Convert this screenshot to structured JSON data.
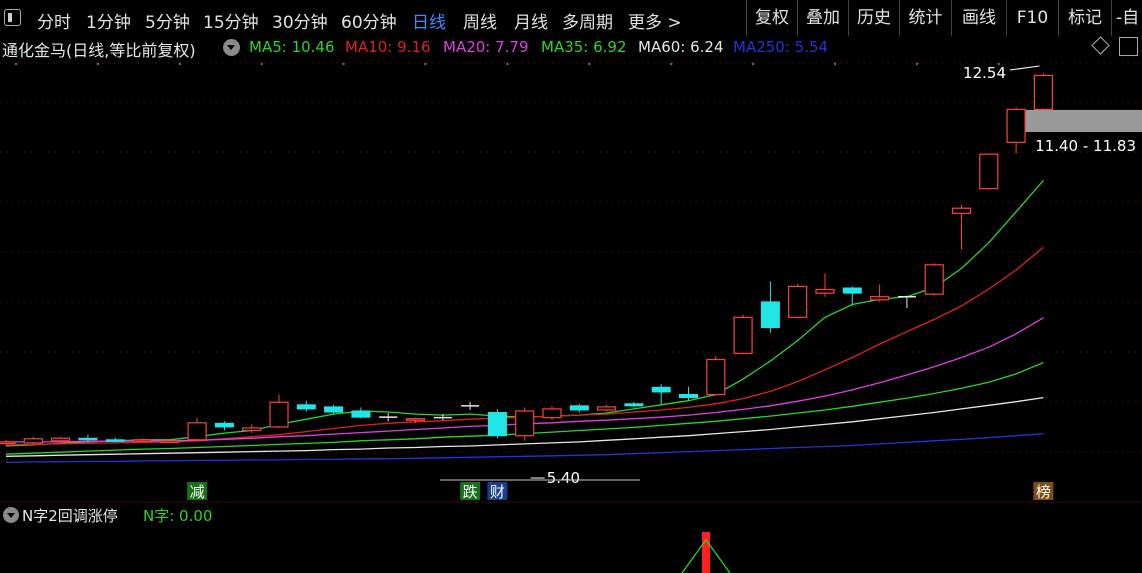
{
  "toolbar": {
    "periods": [
      "分时",
      "1分钟",
      "5分钟",
      "15分钟",
      "30分钟",
      "60分钟",
      "日线",
      "周线",
      "月线",
      "多周期",
      "更多 >"
    ],
    "active_period": "日线",
    "tools": [
      "复权",
      "叠加",
      "历史",
      "统计",
      "画线",
      "F10",
      "标记",
      "-自"
    ]
  },
  "legend": {
    "title": "通化金马(日线,等比前复权)",
    "ma": [
      {
        "label": "MA5: 10.46",
        "color": "#28d628"
      },
      {
        "label": "MA10: 9.16",
        "color": "#e02020"
      },
      {
        "label": "MA20: 7.79",
        "color": "#e040e0"
      },
      {
        "label": "MA35: 6.92",
        "color": "#28d628"
      },
      {
        "label": "MA60: 6.24",
        "color": "#e6e6e6"
      },
      {
        "label": "MA250: 5.54",
        "color": "#2233dd"
      }
    ]
  },
  "chart_data": {
    "type": "candlestick",
    "ylim": [
      4.6,
      12.8
    ],
    "up_color": "#ff4040",
    "down_color": "#20e6e6",
    "candles": [
      {
        "o": 5.35,
        "c": 5.38,
        "h": 5.42,
        "l": 5.3
      },
      {
        "o": 5.36,
        "c": 5.44,
        "h": 5.48,
        "l": 5.33
      },
      {
        "o": 5.4,
        "c": 5.45,
        "h": 5.48,
        "l": 5.38
      },
      {
        "o": 5.45,
        "c": 5.42,
        "h": 5.52,
        "l": 5.38
      },
      {
        "o": 5.42,
        "c": 5.4,
        "h": 5.46,
        "l": 5.37
      },
      {
        "o": 5.4,
        "c": 5.42,
        "h": 5.45,
        "l": 5.38
      },
      {
        "o": 5.38,
        "c": 5.4,
        "h": 5.43,
        "l": 5.35
      },
      {
        "o": 5.42,
        "c": 5.75,
        "h": 5.85,
        "l": 5.4
      },
      {
        "o": 5.74,
        "c": 5.67,
        "h": 5.78,
        "l": 5.6
      },
      {
        "o": 5.6,
        "c": 5.65,
        "h": 5.72,
        "l": 5.55
      },
      {
        "o": 5.67,
        "c": 6.15,
        "h": 6.3,
        "l": 5.65
      },
      {
        "o": 6.1,
        "c": 6.02,
        "h": 6.18,
        "l": 5.97
      },
      {
        "o": 6.06,
        "c": 5.96,
        "h": 6.1,
        "l": 5.92
      },
      {
        "o": 5.98,
        "c": 5.86,
        "h": 6.05,
        "l": 5.84
      },
      {
        "o": 5.86,
        "c": 5.86,
        "h": 5.94,
        "l": 5.78
      },
      {
        "o": 5.8,
        "c": 5.83,
        "h": 5.85,
        "l": 5.75
      },
      {
        "o": 5.85,
        "c": 5.85,
        "h": 5.92,
        "l": 5.8
      },
      {
        "o": 6.08,
        "c": 6.08,
        "h": 6.16,
        "l": 6.0
      },
      {
        "o": 5.95,
        "c": 5.5,
        "h": 6.02,
        "l": 5.45
      },
      {
        "o": 5.5,
        "c": 5.98,
        "h": 6.05,
        "l": 5.4
      },
      {
        "o": 5.85,
        "c": 6.02,
        "h": 6.08,
        "l": 5.8
      },
      {
        "o": 6.08,
        "c": 6.0,
        "h": 6.12,
        "l": 5.95
      },
      {
        "o": 6.0,
        "c": 6.06,
        "h": 6.1,
        "l": 5.97
      },
      {
        "o": 6.12,
        "c": 6.08,
        "h": 6.16,
        "l": 6.05
      },
      {
        "o": 6.44,
        "c": 6.35,
        "h": 6.5,
        "l": 6.1
      },
      {
        "o": 6.3,
        "c": 6.24,
        "h": 6.45,
        "l": 6.18
      },
      {
        "o": 6.3,
        "c": 6.98,
        "h": 7.05,
        "l": 6.28
      },
      {
        "o": 7.1,
        "c": 7.8,
        "h": 7.85,
        "l": 7.08
      },
      {
        "o": 8.1,
        "c": 7.6,
        "h": 8.5,
        "l": 7.5
      },
      {
        "o": 7.8,
        "c": 8.4,
        "h": 8.45,
        "l": 7.78
      },
      {
        "o": 8.27,
        "c": 8.34,
        "h": 8.65,
        "l": 8.2
      },
      {
        "o": 8.37,
        "c": 8.27,
        "h": 8.4,
        "l": 8.03
      },
      {
        "o": 8.14,
        "c": 8.2,
        "h": 8.44,
        "l": 8.1
      },
      {
        "o": 8.2,
        "c": 8.2,
        "h": 8.22,
        "l": 7.98
      },
      {
        "o": 8.25,
        "c": 8.82,
        "h": 8.85,
        "l": 8.22
      },
      {
        "o": 9.82,
        "c": 9.92,
        "h": 9.98,
        "l": 9.12
      },
      {
        "o": 10.3,
        "c": 10.97,
        "h": 10.98,
        "l": 10.28
      },
      {
        "o": 11.2,
        "c": 11.84,
        "h": 11.88,
        "l": 10.98
      },
      {
        "o": 11.84,
        "c": 12.5,
        "h": 12.54,
        "l": 11.82
      }
    ],
    "ma_lines": [
      {
        "name": "MA5",
        "color": "#28d628",
        "values": [
          5.3,
          5.32,
          5.35,
          5.38,
          5.4,
          5.42,
          5.42,
          5.48,
          5.55,
          5.6,
          5.72,
          5.82,
          5.92,
          5.98,
          5.96,
          5.92,
          5.9,
          5.92,
          5.88,
          5.86,
          5.88,
          5.9,
          5.94,
          6.02,
          6.1,
          6.18,
          6.3,
          6.6,
          6.95,
          7.35,
          7.8,
          8.05,
          8.15,
          8.2,
          8.38,
          8.75,
          9.25,
          9.85,
          10.46
        ]
      },
      {
        "name": "MA10",
        "color": "#e02020",
        "values": [
          5.32,
          5.33,
          5.34,
          5.35,
          5.36,
          5.37,
          5.38,
          5.4,
          5.44,
          5.48,
          5.52,
          5.58,
          5.64,
          5.7,
          5.74,
          5.77,
          5.79,
          5.82,
          5.84,
          5.86,
          5.88,
          5.9,
          5.92,
          5.96,
          6.0,
          6.05,
          6.12,
          6.22,
          6.36,
          6.55,
          6.78,
          7.02,
          7.28,
          7.52,
          7.76,
          8.02,
          8.35,
          8.72,
          9.16
        ]
      },
      {
        "name": "MA20",
        "color": "#e040e0",
        "values": [
          5.38,
          5.38,
          5.38,
          5.39,
          5.39,
          5.4,
          5.4,
          5.41,
          5.43,
          5.45,
          5.48,
          5.5,
          5.53,
          5.56,
          5.59,
          5.62,
          5.65,
          5.68,
          5.7,
          5.73,
          5.75,
          5.78,
          5.8,
          5.83,
          5.86,
          5.9,
          5.95,
          6.01,
          6.08,
          6.17,
          6.27,
          6.39,
          6.53,
          6.68,
          6.84,
          7.02,
          7.22,
          7.48,
          7.79
        ]
      },
      {
        "name": "MA35",
        "color": "#28d628",
        "values": [
          5.14,
          5.16,
          5.18,
          5.2,
          5.22,
          5.24,
          5.25,
          5.27,
          5.29,
          5.31,
          5.33,
          5.35,
          5.37,
          5.4,
          5.42,
          5.44,
          5.47,
          5.49,
          5.51,
          5.54,
          5.57,
          5.6,
          5.63,
          5.66,
          5.7,
          5.74,
          5.78,
          5.83,
          5.88,
          5.94,
          6.0,
          6.07,
          6.15,
          6.23,
          6.32,
          6.42,
          6.54,
          6.7,
          6.92
        ]
      },
      {
        "name": "MA60",
        "color": "#e6e6e6",
        "values": [
          5.1,
          5.11,
          5.12,
          5.13,
          5.14,
          5.15,
          5.16,
          5.17,
          5.18,
          5.19,
          5.2,
          5.21,
          5.23,
          5.24,
          5.26,
          5.27,
          5.29,
          5.3,
          5.32,
          5.34,
          5.36,
          5.38,
          5.41,
          5.44,
          5.47,
          5.5,
          5.54,
          5.58,
          5.62,
          5.67,
          5.72,
          5.77,
          5.83,
          5.89,
          5.95,
          6.02,
          6.09,
          6.16,
          6.24
        ]
      },
      {
        "name": "MA250",
        "color": "#2233dd",
        "values": [
          4.98,
          4.99,
          4.99,
          5.0,
          5.0,
          5.01,
          5.01,
          5.02,
          5.02,
          5.03,
          5.03,
          5.04,
          5.04,
          5.05,
          5.05,
          5.06,
          5.07,
          5.08,
          5.09,
          5.1,
          5.11,
          5.12,
          5.13,
          5.15,
          5.17,
          5.19,
          5.21,
          5.23,
          5.25,
          5.27,
          5.29,
          5.31,
          5.34,
          5.37,
          5.4,
          5.43,
          5.46,
          5.5,
          5.54
        ]
      }
    ],
    "annotations": {
      "high_label": "12.54",
      "low_label": "5.40",
      "price_band_label": "11.40 - 11.83"
    },
    "markers": [
      {
        "text": "减",
        "index": 7,
        "bg": "#187018"
      },
      {
        "text": "跌",
        "index": 17,
        "bg": "#187018"
      },
      {
        "text": "财",
        "index": 18,
        "bg": "#1a3e8c"
      },
      {
        "text": "榜",
        "index": 38,
        "bg": "#7a5016"
      }
    ]
  },
  "sub_indicator": {
    "title": "N字2回调涨停",
    "value_label": "N字: 0.00"
  }
}
